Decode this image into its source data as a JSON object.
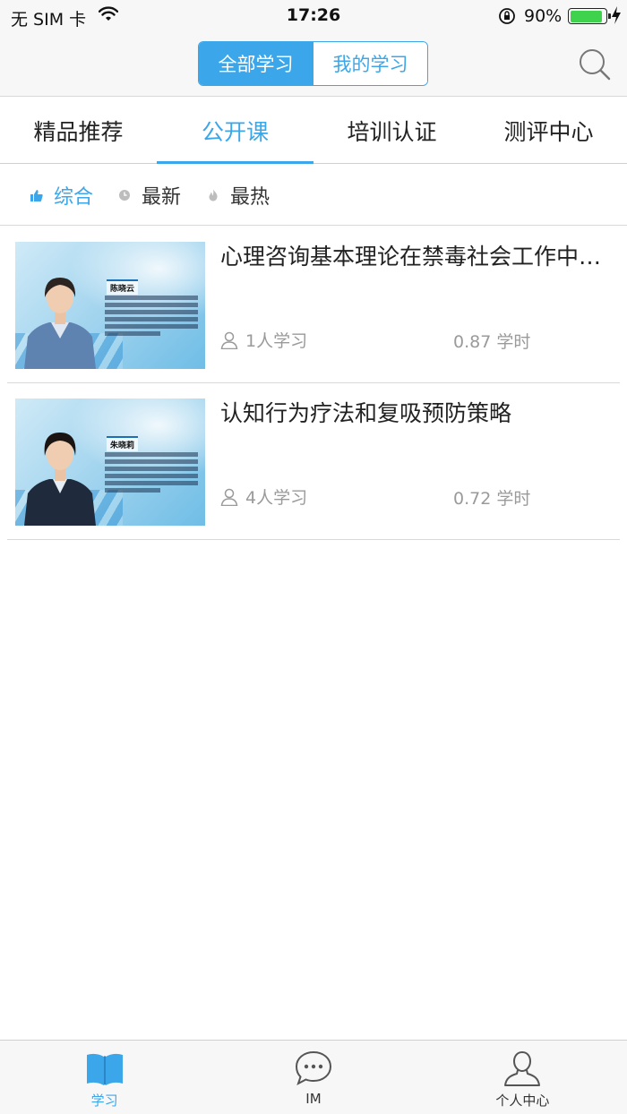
{
  "status_bar": {
    "carrier": "无 SIM 卡",
    "time": "17:26",
    "battery_pct": "90%",
    "battery_level": 0.9
  },
  "header": {
    "segments": [
      {
        "label": "全部学习",
        "selected": true
      },
      {
        "label": "我的学习",
        "selected": false
      }
    ],
    "search_icon": "search-icon"
  },
  "category_tabs": [
    {
      "label": "精品推荐",
      "active": false
    },
    {
      "label": "公开课",
      "active": true
    },
    {
      "label": "培训认证",
      "active": false
    },
    {
      "label": "测评中心",
      "active": false
    }
  ],
  "sort_options": [
    {
      "label": "综合",
      "icon": "thumbs-up-icon",
      "active": true
    },
    {
      "label": "最新",
      "icon": "clock-icon",
      "active": false
    },
    {
      "label": "最热",
      "icon": "flame-icon",
      "active": false
    }
  ],
  "courses": [
    {
      "title": "心理咨询基本理论在禁毒社会工作中的应用",
      "learners": "1人学习",
      "hours": "0.87",
      "hours_unit": "学时",
      "thumb_name": "陈晓云"
    },
    {
      "title": "认知行为疗法和复吸预防策略",
      "learners": "4人学习",
      "hours": "0.72",
      "hours_unit": "学时",
      "thumb_name": "朱晓莉"
    }
  ],
  "tab_bar": [
    {
      "label": "学习",
      "icon": "book-icon",
      "active": true
    },
    {
      "label": "IM",
      "icon": "chat-bubble-icon",
      "active": false
    },
    {
      "label": "个人中心",
      "icon": "person-icon",
      "active": false
    }
  ],
  "colors": {
    "accent": "#3ba7ea",
    "battery": "#3fd24c",
    "muted_text": "#9a9a9a"
  }
}
